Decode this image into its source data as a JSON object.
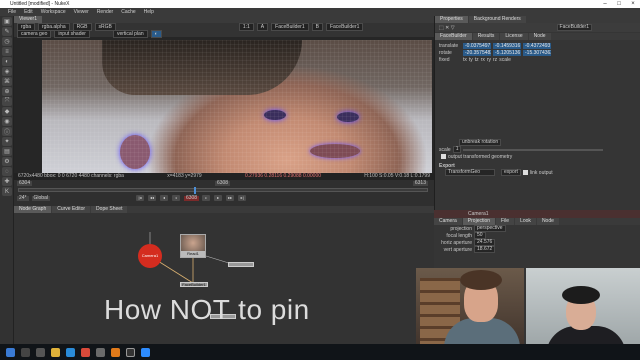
{
  "window": {
    "title": "Untitled [modified] - NukeX"
  },
  "menu": [
    "File",
    "Edit",
    "Workspace",
    "Viewer",
    "Render",
    "Cache",
    "Help"
  ],
  "viewer": {
    "tab": "Viewer1",
    "channels": [
      "rgba",
      "rgba.alpha",
      "RGB",
      "sRGB"
    ],
    "zoom": "1:1",
    "buttons": [
      "camera geo",
      "input shader",
      "vertical plan",
      "A",
      "FaceBuilder1",
      "B",
      "FaceBuilder1"
    ],
    "info_left": "6720x4480 bbox: 0 0 6720 4480 channels: rgba",
    "info_mid": "x=4183 y=2979",
    "info_right": "0.27936 0.28116 0.29088 0.00000",
    "info_hvs": "H:100 S:0.05 V:0.18 L:0.1799",
    "frame_start": "6304",
    "frame_mid": "6308",
    "frame_end": "6313",
    "fps": "24*",
    "global": "Global",
    "current_frame": "6308"
  },
  "nodegraph": {
    "tabs": [
      "Node Graph",
      "Curve Editor",
      "Dope Sheet"
    ],
    "nodes": {
      "camera": "Camera1",
      "read": "Read1",
      "read_sub": "V-T-1.jpg",
      "fb": "FaceBuilder1"
    },
    "overlay_text": "How NOT to pin"
  },
  "properties": {
    "tabs": [
      "Properties",
      "Background Renders"
    ],
    "node_name": "FaceBuilder1",
    "subtabs": [
      "FaceBuilder",
      "Results",
      "License",
      "Node"
    ],
    "translate_label": "translate",
    "translate": [
      "-0.0375497",
      "-0.1459316",
      "-0.4372493"
    ],
    "rotate_label": "rotate",
    "rotate": [
      "-20.3575483",
      "-5.1205136",
      "-15.3074363"
    ],
    "fixed_label": "fixed",
    "fixed_values": [
      "tx",
      "ty",
      "tz",
      "rx",
      "ry",
      "rz",
      "scale"
    ],
    "unbreak_rotation": "unbreak rotation",
    "scale_label": "scale",
    "scale_value": "1",
    "output_transformed": "output transformed geometry",
    "export_label": "Export",
    "export_option": "TransformGeo",
    "export_button": "export",
    "link_output": "link output",
    "camera_panel_title": "Camera1",
    "camera_tabs": [
      "Camera",
      "Projection",
      "File",
      "Look",
      "Node"
    ],
    "projection_label": "projection",
    "projection_value": "perspective",
    "focal_label": "focal length",
    "focal_value": "50",
    "haperture_label": "horiz aperture",
    "haperture_value": "24.576",
    "vaperture_label": "vert aperture",
    "vaperture_value": "18.672"
  },
  "colors": {
    "accent": "#2a5b8a",
    "camera_node": "#d42c1f",
    "overlay": "#dcdcdc"
  }
}
